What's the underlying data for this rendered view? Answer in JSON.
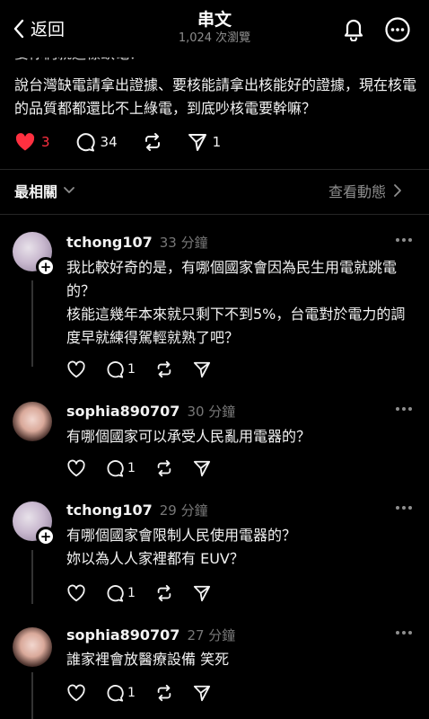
{
  "header": {
    "back_label": "返回",
    "title": "串文",
    "views": "1,024 次瀏覽"
  },
  "post": {
    "cutoff_text": "要你們就這樣缺電？",
    "body": "說台灣缺電請拿出證據、要核能請拿出核能好的證據，現在核電的品質都都還比不上綠電，到底吵核電要幹嘛？",
    "stats": {
      "likes": "3",
      "comments": "34",
      "reposts": "",
      "shares": "1"
    }
  },
  "sort": {
    "label": "最相關",
    "activity_label": "查看動態"
  },
  "comments": [
    {
      "user": "tchong107",
      "time": "33 分鐘",
      "paragraphs": [
        "我比較好奇的是，有哪個國家會因為民生用電就跳電的？",
        "核能這幾年本來就只剩下不到5%，台電對於電力的調度早就練得駕輕就熟了吧？"
      ],
      "comments": "1"
    },
    {
      "user": "sophia890707",
      "time": "30 分鐘",
      "paragraphs": [
        "有哪個國家可以承受人民亂用電器的？"
      ],
      "comments": "1"
    },
    {
      "user": "tchong107",
      "time": "29 分鐘",
      "paragraphs": [
        "有哪個國家會限制人民使用電器的？",
        "妳以為人人家裡都有 EUV？"
      ],
      "comments": "1"
    },
    {
      "user": "sophia890707",
      "time": "27 分鐘",
      "paragraphs": [
        "誰家裡會放醫療設備 笑死"
      ],
      "comments": "1"
    }
  ],
  "colors": {
    "background": "#000000",
    "text": "#f3f3f3",
    "muted": "#8e8e8e",
    "like_red": "#ff3040",
    "divider": "#262626"
  },
  "icons": {
    "back": "chevron-left-icon",
    "notify": "bell-icon",
    "menu": "more-circle-icon",
    "like": "heart-icon",
    "comment": "comment-bubble-icon",
    "repost": "repost-icon",
    "share": "send-icon"
  }
}
